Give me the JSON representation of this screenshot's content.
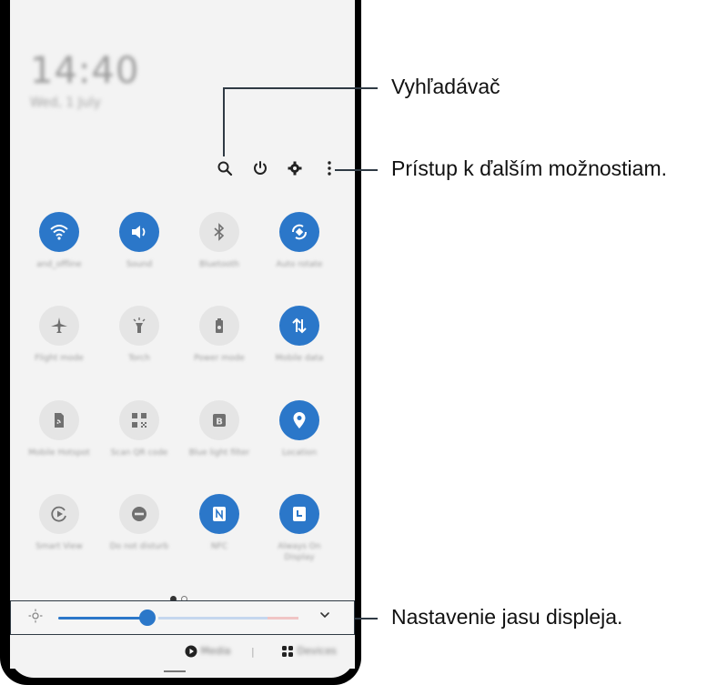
{
  "status": {
    "time": "14:40",
    "date": "Wed, 1 July"
  },
  "top_icons": [
    "search-icon",
    "power-icon",
    "gear-icon",
    "more-vertical-icon"
  ],
  "tiles": [
    {
      "label": "and_offline",
      "icon": "wifi-icon",
      "active": true
    },
    {
      "label": "Sound",
      "icon": "sound-icon",
      "active": true
    },
    {
      "label": "Bluetooth",
      "icon": "bluetooth-icon",
      "active": false
    },
    {
      "label": "Auto rotate",
      "icon": "auto-rotate-icon",
      "active": true
    },
    {
      "label": "Flight mode",
      "icon": "airplane-icon",
      "active": false
    },
    {
      "label": "Torch",
      "icon": "torch-icon",
      "active": false
    },
    {
      "label": "Power mode",
      "icon": "battery-icon",
      "active": false
    },
    {
      "label": "Mobile data",
      "icon": "mobile-data-icon",
      "active": true
    },
    {
      "label": "Mobile Hotspot",
      "icon": "hotspot-icon",
      "active": false
    },
    {
      "label": "Scan QR code",
      "icon": "qr-icon",
      "active": false
    },
    {
      "label": "Blue light filter",
      "icon": "blue-light-icon",
      "active": false
    },
    {
      "label": "Location",
      "icon": "location-icon",
      "active": true
    },
    {
      "label": "Smart View",
      "icon": "smart-view-icon",
      "active": false
    },
    {
      "label": "Do not disturb",
      "icon": "dnd-icon",
      "active": false
    },
    {
      "label": "NFC",
      "icon": "nfc-icon",
      "active": true
    },
    {
      "label": "Always On Display",
      "icon": "aod-icon",
      "active": true
    }
  ],
  "brightness": {
    "level": 0.37
  },
  "bottom": {
    "media": "Media",
    "separator": "|",
    "devices": "Devices"
  },
  "callouts": {
    "search": "Vyhľadávač",
    "more_options": "Prístup k ďalším možnostiam.",
    "brightness": "Nastavenie jasu displeja."
  },
  "colors": {
    "accent": "#2b77c9",
    "callout_line": "#2f3a44"
  }
}
